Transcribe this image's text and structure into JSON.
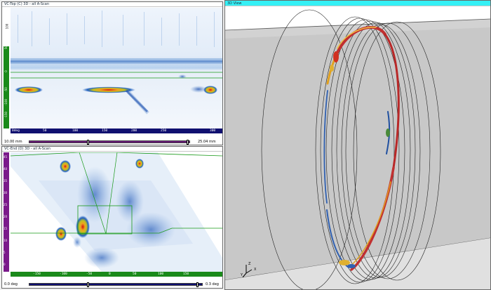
{
  "top_view": {
    "title": "VC-Top (C) 3D - all A-Scan",
    "vruler_ticks": [
      "100",
      "50",
      "0",
      "-50",
      "-100",
      "-150"
    ],
    "hruler_ticks": [
      "0deg",
      "50",
      "100",
      "150",
      "200",
      "250",
      "300"
    ],
    "range_min": "10.00 mm",
    "range_max": "25.04 mm"
  },
  "end_view": {
    "title": "VC-End (D) 3D - all A-Scan",
    "vruler_ticks": [
      "45",
      "40",
      "35",
      "30",
      "25",
      "20",
      "15",
      "10",
      "5",
      "0"
    ],
    "hruler_ticks": [
      "-150",
      "-100",
      "-50",
      "0",
      "50",
      "100",
      "150"
    ],
    "range_min": "0.0 deg",
    "range_max": "0.3 deg"
  },
  "view_3d": {
    "title": "3D View",
    "axes": [
      "X",
      "Y",
      "Z"
    ]
  },
  "colors": {
    "accent": "#35f0f5",
    "ruler_green": "#1a8a1a",
    "ruler_purple": "#7a1a8a",
    "slider_blue": "#101070"
  }
}
